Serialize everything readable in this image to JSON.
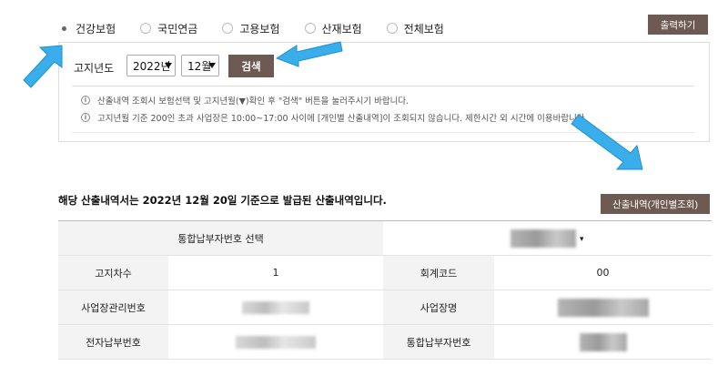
{
  "insurance_types": [
    {
      "label": "건강보험",
      "checked": true
    },
    {
      "label": "국민연금",
      "checked": false
    },
    {
      "label": "고용보험",
      "checked": false
    },
    {
      "label": "산재보험",
      "checked": false
    },
    {
      "label": "전체보험",
      "checked": false
    }
  ],
  "print_button": "출력하기",
  "search": {
    "year_label": "고지년도",
    "year_value": "2022년",
    "month_value": "12월",
    "button": "검색"
  },
  "notices": [
    "산출내역 조회시 보험선택 및 고지년월(▼)확인 후 \"검색\" 버튼을 눌러주시기 바랍니다.",
    "고지년월 기준 200인 초과 사업장은 10:00~17:00 사이에 [개인별 산출내역]이 조회되지 않습니다. 제한시간 외 시간에 이용바랍니다."
  ],
  "result": {
    "title": "해당 산출내역서는 2022년 12월 20일 기준으로 발급된 산출내역입니다.",
    "detail_button": "산출내역(개인별조회)"
  },
  "table": {
    "select_label": "통합납부자번호 선택",
    "rows": [
      {
        "label1": "고지차수",
        "value1": "1",
        "label2": "회계코드",
        "value2": "00"
      },
      {
        "label1": "사업장관리번호",
        "value1": "",
        "label2": "사업장명",
        "value2": ""
      },
      {
        "label1": "전자납부번호",
        "value1": "",
        "label2": "통합납부자번호",
        "value2": ""
      }
    ]
  },
  "colors": {
    "button_bg": "#6d5b53",
    "arrow": "#3aaeea"
  }
}
